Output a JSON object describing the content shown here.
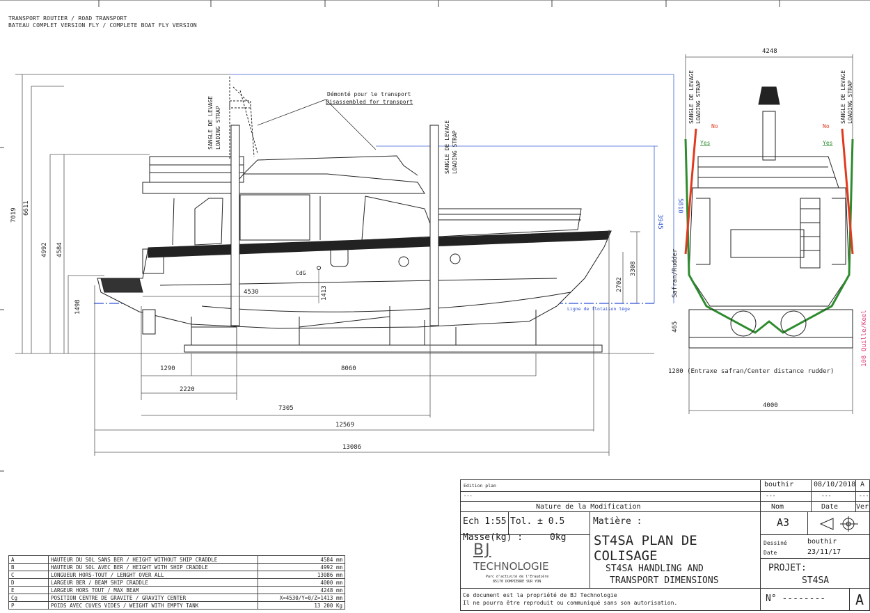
{
  "header": {
    "line1": "TRANSPORT ROUTIER / ROAD TRANSPORT",
    "line2": "BATEAU COMPLET VERSION FLY / COMPLETE BOAT FLY VERSION"
  },
  "side_view": {
    "label_transport_fr": "Démonté pour le transport",
    "label_transport_en": "Disassembled for transport",
    "strap_label_fr": "SANGLE DE LEVAGE",
    "strap_label_en": "LOADING STRAP",
    "cdg_label": "CdG",
    "waterline_label": "Ligne de flotaison lège",
    "dims": {
      "overall_height": "7019",
      "h_6611": "6611",
      "h_4992": "4992",
      "h_4584": "4584",
      "h_1498": "1498",
      "h_5810": "5810",
      "h_3945": "3945",
      "h_3308": "3308",
      "h_2702": "2702",
      "h_1413": "1413",
      "cdg_x": "4530",
      "d_1290": "1290",
      "d_8060": "8060",
      "d_2220": "2220",
      "d_7305": "7305",
      "d_12569": "12569",
      "d_13086": "13086"
    }
  },
  "front_view": {
    "width_top": "4248",
    "width_bottom": "4000",
    "rudder_label": "Safran/Rudder",
    "rudder_dim": "465",
    "keel_label": "Quille/Keel",
    "keel_dim": "108",
    "center_distance": "1280 (Entraxe safran/Center distance rudder)",
    "no_label": "No",
    "yes_label": "Yes",
    "strap_label_fr": "SANGLE DE LEVAGE",
    "strap_label_en": "LOADING STRAP"
  },
  "specs": [
    {
      "key": "A",
      "desc": "HAUTEUR DU SOL SANS BER / HEIGHT WITHOUT SHIP CRADDLE",
      "value": "4584 mm"
    },
    {
      "key": "B",
      "desc": "HAUTEUR DU SOL AVEC BER / HEIGHT WITH SHIP CRADDLE",
      "value": "4992 mm"
    },
    {
      "key": "C",
      "desc": "LONGUEUR HORS-TOUT / LENGHT OVER ALL",
      "value": "13086 mm"
    },
    {
      "key": "D",
      "desc": "LARGEUR BER / BEAM SHIP CRADDLE",
      "value": "4000 mm"
    },
    {
      "key": "E",
      "desc": "LARGEUR HORS TOUT / MAX BEAM",
      "value": "4248 mm"
    },
    {
      "key": "Cg",
      "desc": "POSITION CENTRE DE GRAVITE / GRAVITY CENTER",
      "value": "X=4530/Y=0/Z=1413 mm"
    },
    {
      "key": "P",
      "desc": "POIDS AVEC CUVES VIDES / WEIGHT WITH EMPTY TANK",
      "value": "13 200 Kg"
    }
  ],
  "title_block": {
    "edition": "Edition plan",
    "dashes": "---",
    "modif_header": "Nature de la Modification",
    "author_top": "bouthir",
    "date_top": "08/10/2018",
    "version_top": "A",
    "nom": "Nom",
    "date_label": "Date",
    "ver_label": "Ver.",
    "ech": "Ech   1:55",
    "tol": "Tol. ± 0.5",
    "matiere": "Matière :",
    "masse": "Masse(kg) :",
    "masse_val": "0kg",
    "logo_bj": "BJ",
    "logo_tech": "TECHNOLOGIE",
    "logo_addr1": "Parc d'activité de l'Eraudière",
    "logo_addr2": "85170 DOMPIERRE SUR YON",
    "title_l1": "ST4SA PLAN DE",
    "title_l2": "COLISAGE",
    "title_l3": "ST4SA HANDLING AND",
    "title_l4": "TRANSPORT DIMENSIONS",
    "format": "A3",
    "dessine": "Dessiné",
    "dessine_val": "bouthir",
    "date_small": "Date",
    "date_val": "23/11/17",
    "projet": "PROJET:",
    "projet_val": "ST4SA",
    "property1": "Ce document est la propriété de BJ Technologie",
    "property2": "Il ne pourra être reproduit ou communiqué sans son autorisation.",
    "numero": "N° --------",
    "sheet_letter": "A"
  }
}
